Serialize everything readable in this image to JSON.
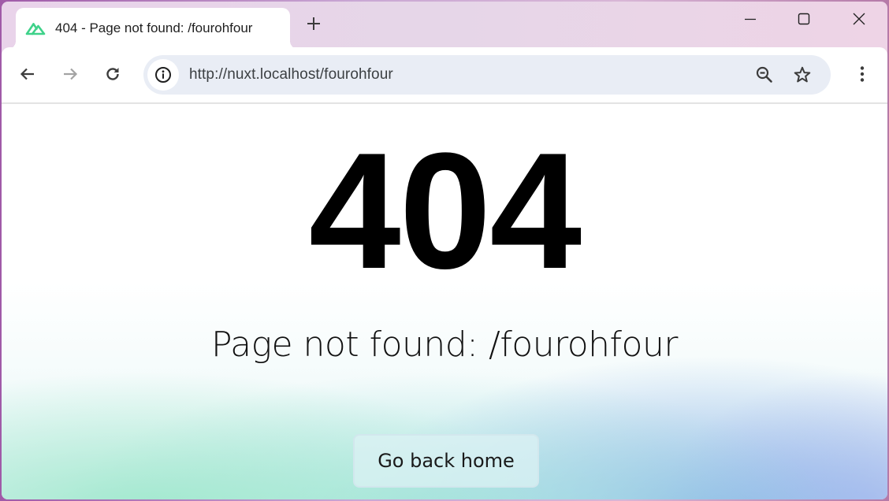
{
  "browser": {
    "tab": {
      "title": "404 - Page not found: /fourohfour",
      "favicon": "nuxt-logo-icon",
      "favicon_color": "#00DC82"
    },
    "new_tab_label": "+",
    "window_controls": [
      "minimize",
      "maximize",
      "close"
    ],
    "toolbar": {
      "back": "arrow-left-icon",
      "forward": "arrow-right-icon",
      "reload": "reload-icon",
      "site_info": "info-icon",
      "url": "http://nuxt.localhost/fourohfour",
      "zoom_indicator": "zoom-out-icon",
      "bookmark": "star-icon",
      "menu": "more-vertical-icon"
    }
  },
  "page": {
    "status_code": "404",
    "message": "Page not found: /fourohfour",
    "home_button_label": "Go back home"
  }
}
